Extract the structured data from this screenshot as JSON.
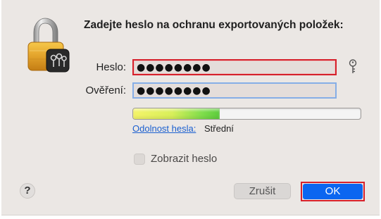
{
  "dialog": {
    "title": "Zadejte heslo na ochranu exportovaných položek:",
    "password": {
      "label": "Heslo:",
      "value": "●●●●●●●●"
    },
    "verify": {
      "label": "Ověření:",
      "value": "●●●●●●●●"
    },
    "strength": {
      "link_label": "Odolnost hesla:",
      "value_label": "Střední",
      "level_fraction": 0.38
    },
    "show_password": {
      "label": "Zobrazit heslo",
      "checked": false
    },
    "help_label": "?",
    "cancel_label": "Zrušit",
    "ok_label": "OK"
  },
  "icons": {
    "lock": "padlock-keychain-icon",
    "key": "key-icon"
  },
  "colors": {
    "dialog_background": "#ebe7e4",
    "highlight_outline": "#d6202b",
    "focus_ring": "#86aee6",
    "ok_button": "#0b66f0",
    "link": "#1a5fd0"
  }
}
